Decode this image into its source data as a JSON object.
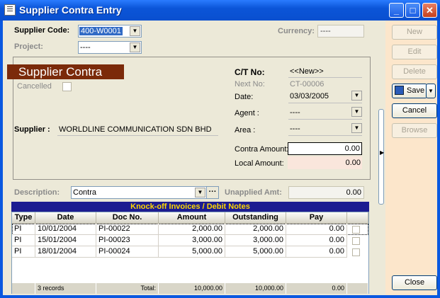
{
  "window": {
    "title": "Supplier Contra Entry",
    "min_label": "_",
    "max_label": "□",
    "close_label": "✕"
  },
  "header": {
    "supplier_code_label": "Supplier Code:",
    "supplier_code_value": "400-W0001",
    "project_label": "Project:",
    "project_value": "----",
    "currency_label": "Currency:",
    "currency_value": "----"
  },
  "form": {
    "banner": "Supplier Contra",
    "cancelled_label": "Cancelled",
    "supplier_label": "Supplier :",
    "supplier_name": "WORLDLINE COMMUNICATION SDN BHD",
    "ct_no_label": "C/T No:",
    "ct_no_value": "<<New>>",
    "next_no_label": "Next No:",
    "next_no_value": "CT-00006",
    "date_label": "Date:",
    "date_value": "03/03/2005",
    "agent_label": "Agent :",
    "agent_value": "----",
    "area_label": "Area :",
    "area_value": "----",
    "contra_amount_label": "Contra Amount:",
    "contra_amount_value": "0.00",
    "local_amount_label": "Local Amount:",
    "local_amount_value": "0.00"
  },
  "description": {
    "label": "Description:",
    "value": "Contra",
    "more_label": "···",
    "unapplied_label": "Unapplied Amt:",
    "unapplied_value": "0.00"
  },
  "grid": {
    "title": "Knock-off Invoices / Debit Notes",
    "columns": [
      "Type",
      "Date",
      "Doc No.",
      "Amount",
      "Outstanding",
      "Pay"
    ],
    "rows": [
      {
        "type": "PI",
        "date": "10/01/2004",
        "doc_no": "PI-00022",
        "amount": "2,000.00",
        "outstanding": "2,000.00",
        "pay": "0.00"
      },
      {
        "type": "PI",
        "date": "15/01/2004",
        "doc_no": "PI-00023",
        "amount": "3,000.00",
        "outstanding": "3,000.00",
        "pay": "0.00"
      },
      {
        "type": "PI",
        "date": "18/01/2004",
        "doc_no": "PI-00024",
        "amount": "5,000.00",
        "outstanding": "5,000.00",
        "pay": "0.00"
      }
    ],
    "footer": {
      "records": "3 records",
      "total_label": "Total:",
      "amount_total": "10,000.00",
      "outstanding_total": "10,000.00",
      "pay_total": "0.00"
    }
  },
  "buttons": {
    "new": "New",
    "edit": "Edit",
    "delete": "Delete",
    "save": "Save",
    "cancel": "Cancel",
    "browse": "Browse",
    "close": "Close"
  }
}
